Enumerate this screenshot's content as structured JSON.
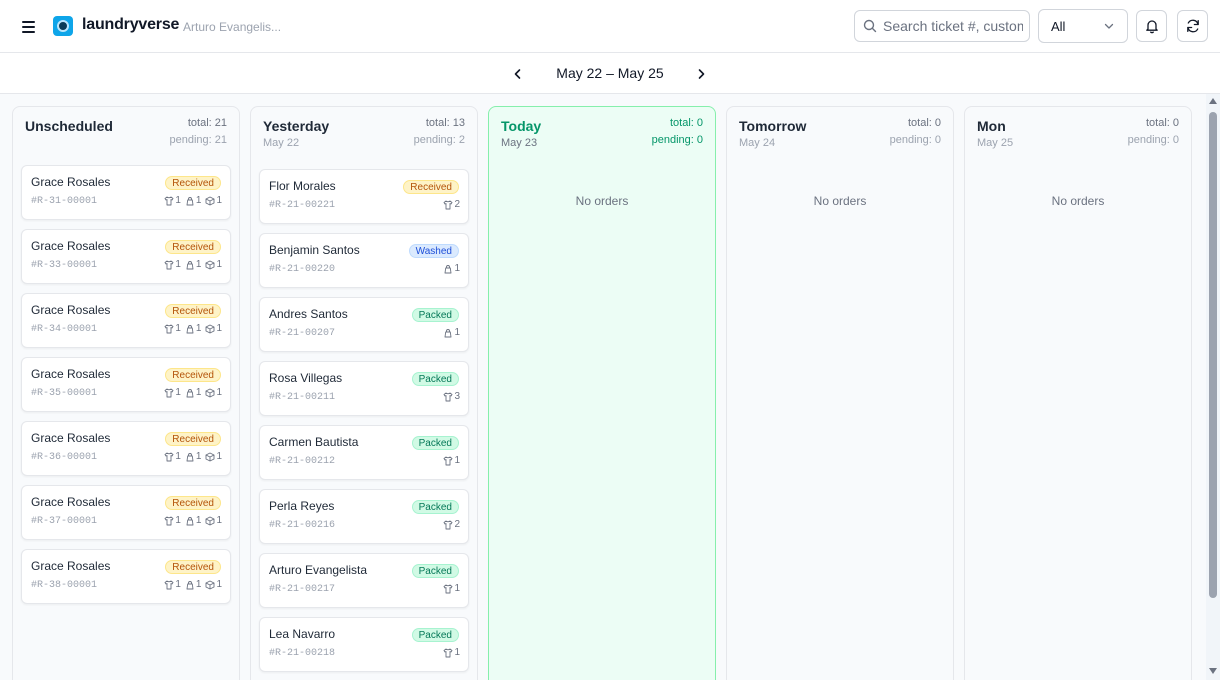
{
  "header": {
    "brand": "laundryverse",
    "user": "Arturo Evangelis...",
    "search_placeholder": "Search ticket #, customer",
    "filter_value": "All",
    "icons": [
      "menu-icon",
      "search-icon",
      "chevron-down-icon",
      "bell-icon",
      "refresh-icon"
    ]
  },
  "datenav": {
    "range": "May 22 – May 25"
  },
  "columns": [
    {
      "title": "Unscheduled",
      "subtitle": "",
      "total": "total: 21",
      "pending": "pending: 21",
      "empty": "",
      "cards": [
        {
          "name": "Grace Rosales",
          "status": "Received",
          "status_key": "received",
          "ticket": "#R-31-00001",
          "items": [
            {
              "icon": "shirt-icon",
              "count": "1"
            },
            {
              "icon": "bag-icon",
              "count": "1"
            },
            {
              "icon": "box-icon",
              "count": "1"
            }
          ]
        },
        {
          "name": "Grace Rosales",
          "status": "Received",
          "status_key": "received",
          "ticket": "#R-33-00001",
          "items": [
            {
              "icon": "shirt-icon",
              "count": "1"
            },
            {
              "icon": "bag-icon",
              "count": "1"
            },
            {
              "icon": "box-icon",
              "count": "1"
            }
          ]
        },
        {
          "name": "Grace Rosales",
          "status": "Received",
          "status_key": "received",
          "ticket": "#R-34-00001",
          "items": [
            {
              "icon": "shirt-icon",
              "count": "1"
            },
            {
              "icon": "bag-icon",
              "count": "1"
            },
            {
              "icon": "box-icon",
              "count": "1"
            }
          ]
        },
        {
          "name": "Grace Rosales",
          "status": "Received",
          "status_key": "received",
          "ticket": "#R-35-00001",
          "items": [
            {
              "icon": "shirt-icon",
              "count": "1"
            },
            {
              "icon": "bag-icon",
              "count": "1"
            },
            {
              "icon": "box-icon",
              "count": "1"
            }
          ]
        },
        {
          "name": "Grace Rosales",
          "status": "Received",
          "status_key": "received",
          "ticket": "#R-36-00001",
          "items": [
            {
              "icon": "shirt-icon",
              "count": "1"
            },
            {
              "icon": "bag-icon",
              "count": "1"
            },
            {
              "icon": "box-icon",
              "count": "1"
            }
          ]
        },
        {
          "name": "Grace Rosales",
          "status": "Received",
          "status_key": "received",
          "ticket": "#R-37-00001",
          "items": [
            {
              "icon": "shirt-icon",
              "count": "1"
            },
            {
              "icon": "bag-icon",
              "count": "1"
            },
            {
              "icon": "box-icon",
              "count": "1"
            }
          ]
        },
        {
          "name": "Grace Rosales",
          "status": "Received",
          "status_key": "received",
          "ticket": "#R-38-00001",
          "items": [
            {
              "icon": "shirt-icon",
              "count": "1"
            },
            {
              "icon": "bag-icon",
              "count": "1"
            },
            {
              "icon": "box-icon",
              "count": "1"
            }
          ]
        }
      ]
    },
    {
      "title": "Yesterday",
      "subtitle": "May 22",
      "total": "total: 13",
      "pending": "pending: 2",
      "empty": "",
      "cards": [
        {
          "name": "Flor Morales",
          "status": "Received",
          "status_key": "received",
          "ticket": "#R-21-00221",
          "items": [
            {
              "icon": "shirt-icon",
              "count": "2"
            }
          ]
        },
        {
          "name": "Benjamin Santos",
          "status": "Washed",
          "status_key": "washed",
          "ticket": "#R-21-00220",
          "items": [
            {
              "icon": "bag-icon",
              "count": "1"
            }
          ]
        },
        {
          "name": "Andres Santos",
          "status": "Packed",
          "status_key": "packed",
          "ticket": "#R-21-00207",
          "items": [
            {
              "icon": "bag-icon",
              "count": "1"
            }
          ]
        },
        {
          "name": "Rosa Villegas",
          "status": "Packed",
          "status_key": "packed",
          "ticket": "#R-21-00211",
          "items": [
            {
              "icon": "shirt-icon",
              "count": "3"
            }
          ]
        },
        {
          "name": "Carmen Bautista",
          "status": "Packed",
          "status_key": "packed",
          "ticket": "#R-21-00212",
          "items": [
            {
              "icon": "shirt-icon",
              "count": "1"
            }
          ]
        },
        {
          "name": "Perla Reyes",
          "status": "Packed",
          "status_key": "packed",
          "ticket": "#R-21-00216",
          "items": [
            {
              "icon": "shirt-icon",
              "count": "2"
            }
          ]
        },
        {
          "name": "Arturo Evangelista",
          "status": "Packed",
          "status_key": "packed",
          "ticket": "#R-21-00217",
          "items": [
            {
              "icon": "shirt-icon",
              "count": "1"
            }
          ]
        },
        {
          "name": "Lea Navarro",
          "status": "Packed",
          "status_key": "packed",
          "ticket": "#R-21-00218",
          "items": [
            {
              "icon": "shirt-icon",
              "count": "1"
            }
          ]
        }
      ]
    },
    {
      "title": "Today",
      "subtitle": "May 23",
      "total": "total: 0",
      "pending": "pending: 0",
      "empty": "No orders",
      "cards": []
    },
    {
      "title": "Tomorrow",
      "subtitle": "May 24",
      "total": "total: 0",
      "pending": "pending: 0",
      "empty": "No orders",
      "cards": []
    },
    {
      "title": "Mon",
      "subtitle": "May 25",
      "total": "total: 0",
      "pending": "pending: 0",
      "empty": "No orders",
      "cards": []
    }
  ],
  "colors": {
    "accent": "#0ea5e9",
    "today": "#059669",
    "received": "#b45309",
    "washed": "#1d4ed8",
    "packed": "#047857"
  }
}
